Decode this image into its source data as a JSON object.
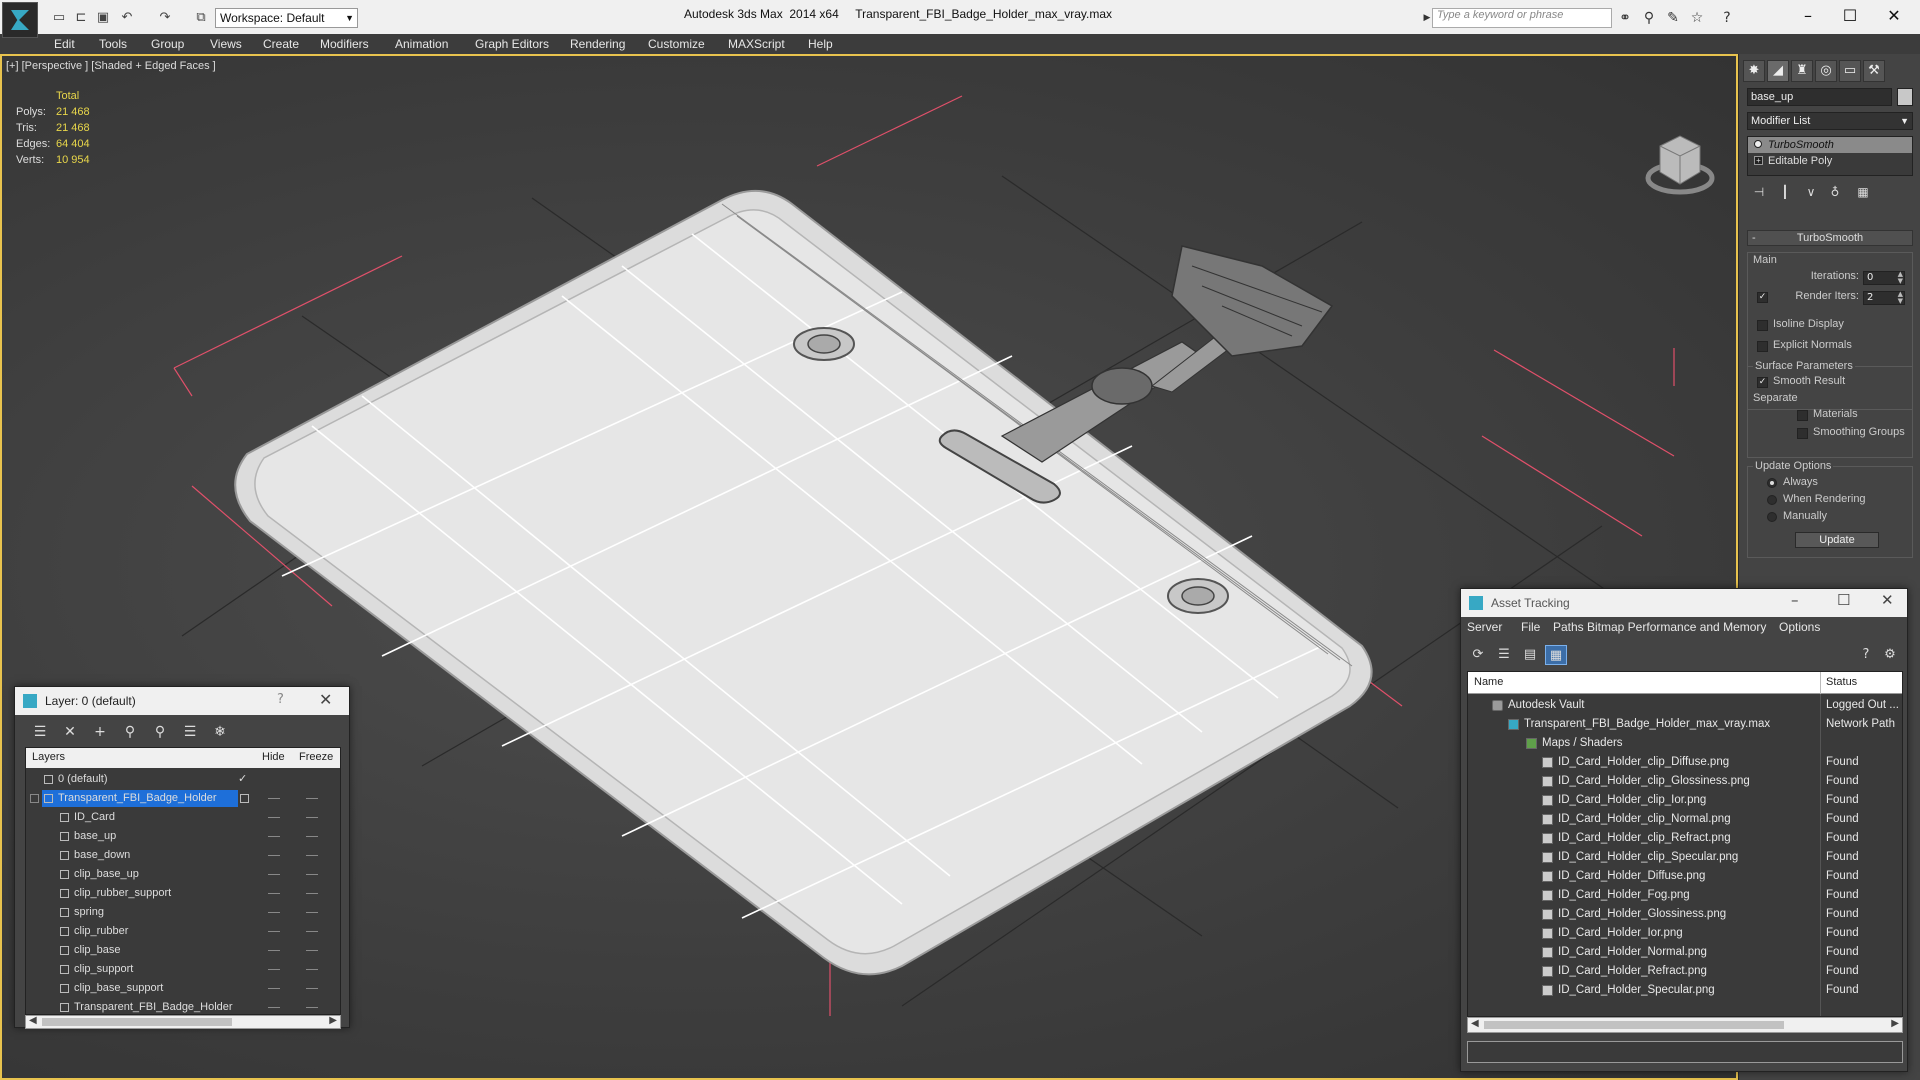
{
  "titlebar": {
    "workspace": "Workspace: Default",
    "app_title": "Autodesk 3ds Max  2014 x64",
    "file_title": "Transparent_FBI_Badge_Holder_max_vray.max",
    "search_placeholder": "Type a keyword or phrase",
    "minimize": "–",
    "maximize": "☐",
    "close": "✕"
  },
  "menu": [
    "Edit",
    "Tools",
    "Group",
    "Views",
    "Create",
    "Modifiers",
    "Animation",
    "Graph Editors",
    "Rendering",
    "Customize",
    "MAXScript",
    "Help"
  ],
  "viewport": {
    "label": "[+] [Perspective ] [Shaded + Edged Faces ]",
    "stats": {
      "header": "Total",
      "rows": [
        {
          "label": "Polys:",
          "value": "21 468"
        },
        {
          "label": "Tris:",
          "value": "21 468"
        },
        {
          "label": "Edges:",
          "value": "64 404"
        },
        {
          "label": "Verts:",
          "value": "10 954"
        }
      ]
    }
  },
  "command_panel": {
    "object_name": "base_up",
    "modifier_list": "Modifier List",
    "stack": [
      "TurboSmooth",
      "Editable Poly"
    ],
    "rollout_title": "TurboSmooth",
    "main_label": "Main",
    "iterations_label": "Iterations:",
    "iterations_value": "0",
    "render_iters_label": "Render Iters:",
    "render_iters_value": "2",
    "isoline_label": "Isoline Display",
    "explicit_normals_label": "Explicit Normals",
    "surface_params_label": "Surface Parameters",
    "smooth_result_label": "Smooth Result",
    "separate_label": "Separate",
    "materials_label": "Materials",
    "smoothing_groups_label": "Smoothing Groups",
    "update_options_label": "Update Options",
    "always_label": "Always",
    "when_rendering_label": "When Rendering",
    "manually_label": "Manually",
    "update_button": "Update"
  },
  "layer_dialog": {
    "title": "Layer: 0 (default)",
    "help": "?",
    "close": "✕",
    "col_layers": "Layers",
    "col_hide": "Hide",
    "col_freeze": "Freeze",
    "rows": [
      {
        "name": "0 (default)",
        "level": 0
      },
      {
        "name": "Transparent_FBI_Badge_Holder",
        "level": 0,
        "selected": true
      },
      {
        "name": "ID_Card",
        "level": 1
      },
      {
        "name": "base_up",
        "level": 1
      },
      {
        "name": "base_down",
        "level": 1
      },
      {
        "name": "clip_base_up",
        "level": 1
      },
      {
        "name": "clip_rubber_support",
        "level": 1
      },
      {
        "name": "spring",
        "level": 1
      },
      {
        "name": "clip_rubber",
        "level": 1
      },
      {
        "name": "clip_base",
        "level": 1
      },
      {
        "name": "clip_support",
        "level": 1
      },
      {
        "name": "clip_base_support",
        "level": 1
      },
      {
        "name": "Transparent_FBI_Badge_Holder",
        "level": 1
      }
    ]
  },
  "asset_tracking": {
    "title": "Asset Tracking",
    "menu": [
      "Server",
      "File",
      "Paths",
      "Bitmap Performance and Memory",
      "Options"
    ],
    "col_name": "Name",
    "col_status": "Status",
    "rows": [
      {
        "name": "Autodesk Vault",
        "status": "Logged Out ...",
        "level": 0,
        "type": "vault"
      },
      {
        "name": "Transparent_FBI_Badge_Holder_max_vray.max",
        "status": "Network Path",
        "level": 1,
        "type": "maxf"
      },
      {
        "name": "Maps / Shaders",
        "status": "",
        "level": 2,
        "type": "folder"
      },
      {
        "name": "ID_Card_Holder_clip_Diffuse.png",
        "status": "Found",
        "level": 3,
        "type": "file"
      },
      {
        "name": "ID_Card_Holder_clip_Glossiness.png",
        "status": "Found",
        "level": 3,
        "type": "file"
      },
      {
        "name": "ID_Card_Holder_clip_Ior.png",
        "status": "Found",
        "level": 3,
        "type": "file"
      },
      {
        "name": "ID_Card_Holder_clip_Normal.png",
        "status": "Found",
        "level": 3,
        "type": "file"
      },
      {
        "name": "ID_Card_Holder_clip_Refract.png",
        "status": "Found",
        "level": 3,
        "type": "file"
      },
      {
        "name": "ID_Card_Holder_clip_Specular.png",
        "status": "Found",
        "level": 3,
        "type": "file"
      },
      {
        "name": "ID_Card_Holder_Diffuse.png",
        "status": "Found",
        "level": 3,
        "type": "file"
      },
      {
        "name": "ID_Card_Holder_Fog.png",
        "status": "Found",
        "level": 3,
        "type": "file"
      },
      {
        "name": "ID_Card_Holder_Glossiness.png",
        "status": "Found",
        "level": 3,
        "type": "file"
      },
      {
        "name": "ID_Card_Holder_Ior.png",
        "status": "Found",
        "level": 3,
        "type": "file"
      },
      {
        "name": "ID_Card_Holder_Normal.png",
        "status": "Found",
        "level": 3,
        "type": "file"
      },
      {
        "name": "ID_Card_Holder_Refract.png",
        "status": "Found",
        "level": 3,
        "type": "file"
      },
      {
        "name": "ID_Card_Holder_Specular.png",
        "status": "Found",
        "level": 3,
        "type": "file"
      }
    ]
  },
  "colors": {
    "accent": "#e8c34e",
    "selection": "#1e6fd9",
    "stat_value": "#e8d64a",
    "bbox": "#e0506a"
  }
}
